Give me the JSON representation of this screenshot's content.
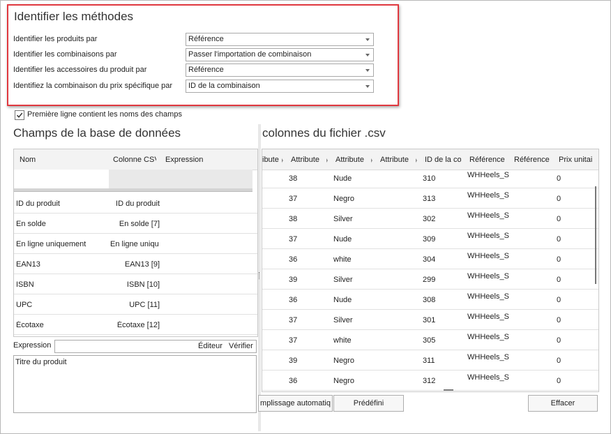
{
  "methods": {
    "title": "Identifier les méthodes",
    "rows": [
      {
        "label": "Identifier les produits par",
        "value": "Référence"
      },
      {
        "label": "Identifier les combinaisons par",
        "value": "Passer l'importation de combinaison"
      },
      {
        "label": "Identifier les accessoires du produit par",
        "value": "Référence"
      },
      {
        "label": "Identifiez la combinaison du prix spécifique par",
        "value": "ID de la combinaison"
      }
    ]
  },
  "first_line_checkbox": {
    "label": "Première ligne contient les noms des champs",
    "checked": true
  },
  "db_fields": {
    "title": "Champs de la base de données",
    "columns": [
      "Nom",
      "Colonne CSV",
      "Expression"
    ],
    "rows": [
      {
        "nom": "ID du produit",
        "colonne": "ID du produit",
        "expression": ""
      },
      {
        "nom": "En solde",
        "colonne": "En solde [7]",
        "expression": ""
      },
      {
        "nom": "En ligne uniquement",
        "colonne": "En ligne uniqu",
        "expression": ""
      },
      {
        "nom": "EAN13",
        "colonne": "EAN13 [9]",
        "expression": ""
      },
      {
        "nom": "ISBN",
        "colonne": "ISBN [10]",
        "expression": ""
      },
      {
        "nom": "UPC",
        "colonne": "UPC [11]",
        "expression": ""
      },
      {
        "nom": "Écotaxe",
        "colonne": "Écotaxe [12]",
        "expression": ""
      }
    ],
    "expression_label": "Expression",
    "editor_button": "Éditeur",
    "verify_button": "Vérifier",
    "expression_text": "Titre du produit"
  },
  "csv": {
    "title": "colonnes du fichier .csv",
    "columns": [
      "ibute",
      "Attribute",
      "Attribute",
      "Attribute",
      "ID de la co",
      "Référence",
      "Référence",
      "Prix unitai"
    ],
    "rows": [
      {
        "c1": "38",
        "c2": "Nude",
        "c4": "310",
        "c5": "WHHeels_S",
        "c7": "0"
      },
      {
        "c1": "37",
        "c2": "Negro",
        "c4": "313",
        "c5": "WHHeels_S",
        "c7": "0"
      },
      {
        "c1": "38",
        "c2": "Silver",
        "c4": "302",
        "c5": "WHHeels_S",
        "c7": "0"
      },
      {
        "c1": "37",
        "c2": "Nude",
        "c4": "309",
        "c5": "WHHeels_S",
        "c7": "0"
      },
      {
        "c1": "36",
        "c2": "white",
        "c4": "304",
        "c5": "WHHeels_S",
        "c7": "0"
      },
      {
        "c1": "39",
        "c2": "Silver",
        "c4": "299",
        "c5": "WHHeels_S",
        "c7": "0"
      },
      {
        "c1": "36",
        "c2": "Nude",
        "c4": "308",
        "c5": "WHHeels_S",
        "c7": "0"
      },
      {
        "c1": "37",
        "c2": "Silver",
        "c4": "301",
        "c5": "WHHeels_S",
        "c7": "0"
      },
      {
        "c1": "37",
        "c2": "white",
        "c4": "305",
        "c5": "WHHeels_S",
        "c7": "0"
      },
      {
        "c1": "39",
        "c2": "Negro",
        "c4": "311",
        "c5": "WHHeels_S",
        "c7": "0"
      },
      {
        "c1": "36",
        "c2": "Negro",
        "c4": "312",
        "c5": "WHHeels_S",
        "c7": "0"
      }
    ],
    "auto_fill_button": "mplissage automatiq",
    "preset_button": "Prédéfini",
    "clear_button": "Effacer"
  }
}
